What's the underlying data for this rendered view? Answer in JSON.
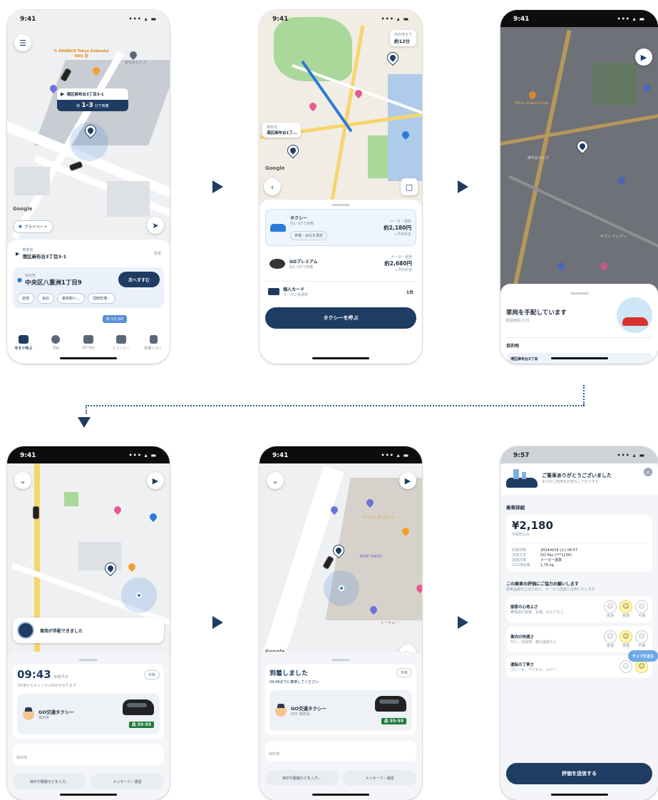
{
  "colors": {
    "navy": "#1f3c63",
    "accent": "#2c79d6",
    "green_plate": "#1e7a3a",
    "orange_poi": "#f0a030"
  },
  "status": {
    "time_1": "9:41",
    "time_6": "9:57",
    "signal": "••• ▴ ▬"
  },
  "screen1": {
    "poi_top": "% ARABICA Tokyo Azabudai Hills 店",
    "poi_hills": "麻布台ヒルズ",
    "pickup_marker": "港区麻布台3丁目3-1",
    "eta_prefix": "約",
    "eta_value": "1-3",
    "eta_suffix": "分で到着",
    "map_logo": "Google",
    "privacy_chip": "プライベート",
    "pickup_label": "乗車地",
    "pickup_address": "港区麻布台3丁目3-1",
    "pickup_edit": "変更",
    "dest_label": "目的地",
    "dest_address": "中央区八重洲1丁目9",
    "next_button": "次へすすむ",
    "shortcuts": [
      "自宅",
      "会社",
      "東京駅八…",
      "羽田空港…"
    ],
    "badge": "約 1分 GO",
    "tabs": [
      "今すぐ呼ぶ",
      "予約",
      "GO Pay",
      "エコノミー",
      "配車リスト"
    ]
  },
  "screen2": {
    "eta_top": "目的地まで",
    "eta_value": "約12分",
    "pickup_marker_label": "乗車地",
    "pickup_marker": "港区麻布台1丁…",
    "map_logo": "Google",
    "taxi_name": "タクシー",
    "taxi_eta": "約1-3分で到着",
    "taxi_tag": "車種・会社を選択",
    "taxi_fare_label": "メーター運賃",
    "taxi_fare": "約2,180円",
    "taxi_fare_note": "+予約料金",
    "premium_name": "GOプレミアム",
    "premium_eta": "約1-3分で到着",
    "premium_fare_label": "メーター運賃",
    "premium_fare": "約2,680円",
    "premium_fare_note": "+予約料金",
    "payment": "個人カード",
    "coupon": "クーポン未選択",
    "passengers": "1台",
    "call_button": "タクシーを呼ぶ"
  },
  "screen3": {
    "poi_hills": "麻布台ヒルズ",
    "poi_arabica": "Tokyo Arabica Club",
    "poi_seven": "セブン-イレブン",
    "title": "車両を手配しています",
    "elapsed": "経過時間 0:01",
    "dest_heading": "目的地",
    "dest_address": "港区麻布台3丁目"
  },
  "screen4": {
    "banner": "車両が手配できました",
    "arrival_time": "09:43",
    "arrival_label": "到着予定",
    "share": "共有",
    "cancel_note": "3分後からキャンセル料がかかります",
    "company": "GO交通タクシー",
    "car_type": "乗用車",
    "plate": "品 55-55",
    "dest_label": "目的地",
    "memo": "目印や服装などを入力…",
    "message": "メッセージ・通話"
  },
  "screen5": {
    "poi_truetokyo": "TRUE TOKYO",
    "poi_ritz": "リッツ・カールトン",
    "poi_toraya": "トーキョー",
    "map_logo": "Google",
    "title": "到着しました",
    "share": "共有",
    "note": "09:48までに乗車してください",
    "company": "GO交通タクシー",
    "driver": "田中 乗務員",
    "plate": "品 55-55",
    "dest_label": "目的地",
    "memo": "目印や服装などを入力…",
    "message": "メッセージ・通話"
  },
  "screen6": {
    "thanks": "ご乗車ありがとうございました",
    "thanks_sub": "またのご利用をお待ちしております",
    "detail_heading": "乗車詳細",
    "price": "¥2,180",
    "price_label": "手配料込み",
    "detail_rows": [
      {
        "label": "利用日時",
        "value": "2024/4/16 (火) 09:57"
      },
      {
        "label": "決済方法",
        "value": "GO Pay (***1234)"
      },
      {
        "label": "運賃計算",
        "value": "メーター運賃"
      },
      {
        "label": "CO2排出量",
        "value": "1.79 kg"
      }
    ],
    "rating_heading": "この乗車の評価にご協力お願いします",
    "rating_sub": "配車品質向上のために、サービス改善に活用いたします",
    "ratings": [
      {
        "title": "接客の心地よさ",
        "desc": "乗務員の挨拶、言葉、おもてなし"
      },
      {
        "title": "車内の快適さ",
        "desc": "匂い、清潔感、車内温度など"
      },
      {
        "title": "運転の丁寧さ",
        "desc": "ブレーキ、アクセル、スピー…"
      }
    ],
    "face_labels": [
      "普通",
      "普通",
      "不満"
    ],
    "tip_button": "チップを送る",
    "submit_button": "評価を送信する"
  }
}
